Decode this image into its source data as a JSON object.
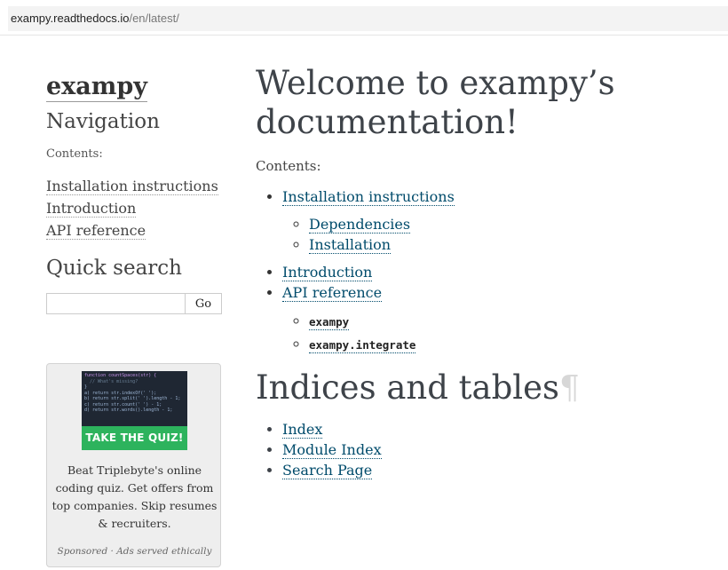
{
  "url": {
    "host": "exampy.readthedocs.io",
    "path": "/en/latest/"
  },
  "sidebar": {
    "logo": "exampy",
    "navigation_title": "Navigation",
    "contents_caption": "Contents:",
    "items": [
      {
        "label": "Installation instructions"
      },
      {
        "label": "Introduction"
      },
      {
        "label": "API reference"
      }
    ],
    "quick_search_title": "Quick search",
    "search": {
      "value": "",
      "placeholder": "",
      "go_label": "Go"
    }
  },
  "ad": {
    "code_lines": [
      "function countSpaces(str) {",
      "  // What's missing?",
      "}",
      "a) return str.indexOf(' ');",
      "b) return str.split(' ').length - 1;",
      "c) return str.count(' ') - 1;",
      "d) return str.words().length - 1;"
    ],
    "cta": "TAKE THE QUIZ!",
    "text": "Beat Triplebyte's online coding quiz. Get offers from top companies. Skip resumes & recruiters.",
    "footer": "Sponsored · Ads served ethically"
  },
  "main": {
    "title": "Welcome to exampy’s documentation!",
    "contents_caption": "Contents:",
    "toc": {
      "install": "Installation instructions",
      "install_sub": [
        "Dependencies",
        "Installation"
      ],
      "intro": "Introduction",
      "api": "API reference",
      "api_sub": [
        "exampy",
        "exampy.integrate"
      ]
    },
    "indices_title": "Indices and tables",
    "pilcrow": "¶",
    "indices": [
      "Index",
      "Module Index",
      "Search Page"
    ]
  }
}
